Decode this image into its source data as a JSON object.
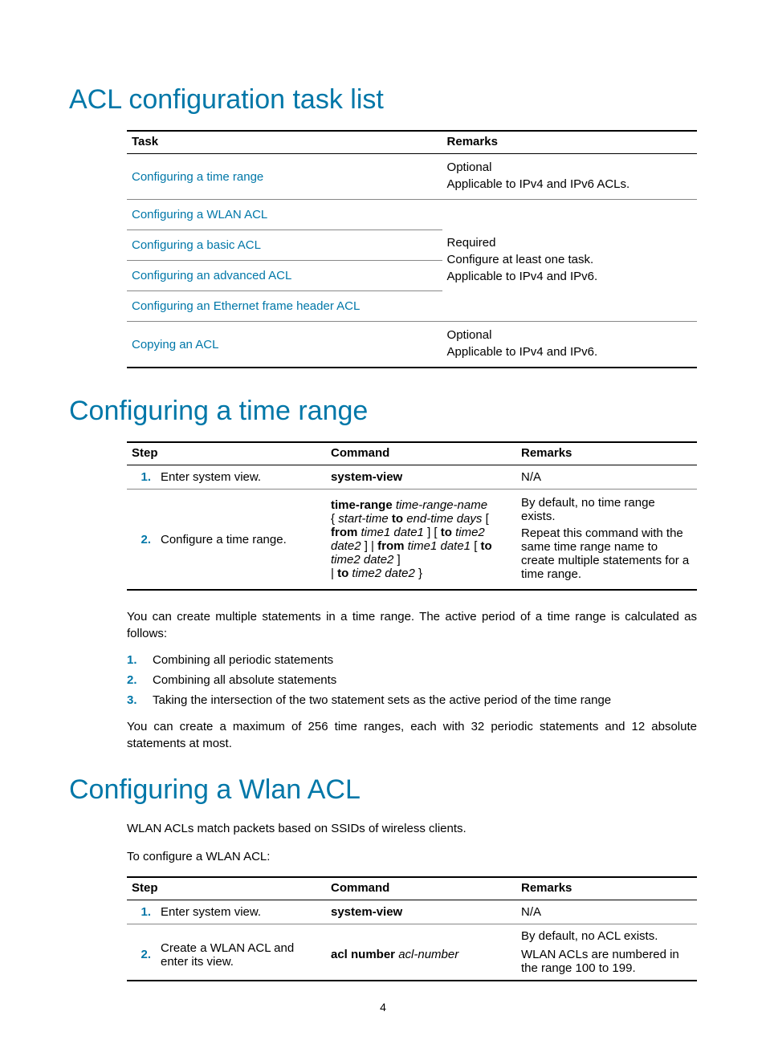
{
  "pageNumber": "4",
  "section1": {
    "title": "ACL configuration task list",
    "table": {
      "headers": [
        "Task",
        "Remarks"
      ],
      "rows": [
        {
          "task": "Configuring a time range",
          "isLink": true,
          "remarks": [
            "Optional",
            "Applicable to IPv4 and IPv6 ACLs."
          ]
        },
        {
          "task": "Configuring a WLAN ACL",
          "isLink": true
        },
        {
          "task": "Configuring a basic ACL",
          "isLink": true,
          "groupRemarks": [
            "Required",
            "Configure at least one task.",
            "Applicable to IPv4 and IPv6."
          ]
        },
        {
          "task": "Configuring an advanced ACL",
          "isLink": true
        },
        {
          "task": "Configuring an Ethernet frame header ACL",
          "isLink": true
        },
        {
          "task": "Copying an ACL",
          "isLink": true,
          "remarks": [
            "Optional",
            "Applicable to IPv4 and IPv6."
          ]
        }
      ]
    }
  },
  "section2": {
    "title": "Configuring a time range",
    "table": {
      "headers": [
        "Step",
        "Command",
        "Remarks"
      ],
      "rows": [
        {
          "num": "1.",
          "step": "Enter system view.",
          "command_bold": "system-view",
          "remarks": "N/A"
        },
        {
          "num": "2.",
          "step": "Configure a time range.",
          "command_parts": {
            "p1_b": "time-range",
            "p1_i": " time-range-name",
            "p2_a": "{ ",
            "p2_i1": "start-time",
            "p2_b1": " to ",
            "p2_i2": "end-time days",
            "p2_c": " [ ",
            "p2_b2": "from",
            "p3_i1": " time1 date1",
            "p3_c1": " ] [ ",
            "p3_b1": "to",
            "p3_i2": " time2 date2",
            "p3_c2": " ] | ",
            "p4_b1": "from",
            "p4_i1": " time1 date1",
            "p4_c1": " [ ",
            "p4_b2": "to",
            "p4_i2": " time2 date2",
            "p4_c2": " ] ",
            "p5_a": "| ",
            "p5_b": "to",
            "p5_i": " time2 date2",
            "p5_c": " }"
          },
          "remarks1": "By default, no time range exists.",
          "remarks2": "Repeat this command with the same time range name to create multiple statements for a time range."
        }
      ]
    },
    "para1": "You can create multiple statements in a time range. The active period of a time range is calculated as follows:",
    "list": [
      {
        "num": "1.",
        "text": "Combining all periodic statements"
      },
      {
        "num": "2.",
        "text": "Combining all absolute statements"
      },
      {
        "num": "3.",
        "text": "Taking the intersection of the two statement sets as the active period of the time range"
      }
    ],
    "para2": "You can create a maximum of 256 time ranges, each with 32 periodic statements and 12 absolute statements at most."
  },
  "section3": {
    "title": "Configuring a Wlan ACL",
    "para1": "WLAN ACLs match packets based on SSIDs of wireless clients.",
    "para2": "To configure a WLAN ACL:",
    "table": {
      "headers": [
        "Step",
        "Command",
        "Remarks"
      ],
      "rows": [
        {
          "num": "1.",
          "step": "Enter system view.",
          "command_bold": "system-view",
          "remarks": "N/A"
        },
        {
          "num": "2.",
          "step": "Create a WLAN ACL and enter its view.",
          "command_b": "acl number",
          "command_i": " acl-number",
          "remarks1": "By default, no ACL exists.",
          "remarks2": "WLAN ACLs are numbered in the range 100 to 199."
        }
      ]
    }
  }
}
